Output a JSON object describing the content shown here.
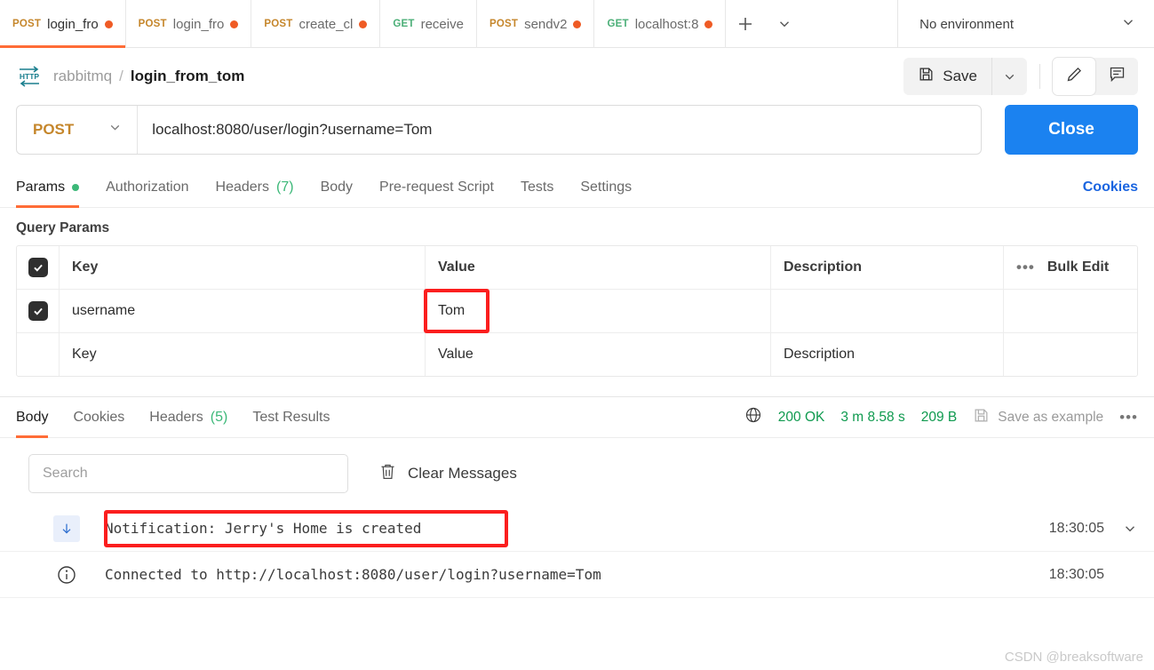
{
  "tabbar": {
    "tabs": [
      {
        "method": "POST",
        "name": "login_from_tom",
        "display": "login_fro",
        "dirty": true,
        "active": true
      },
      {
        "method": "POST",
        "name": "login_from_jerry",
        "display": "login_fro",
        "dirty": true,
        "active": false
      },
      {
        "method": "POST",
        "name": "create_cl",
        "display": "create_cl",
        "dirty": true,
        "active": false
      },
      {
        "method": "GET",
        "name": "receive",
        "display": "receive",
        "dirty": false,
        "active": false
      },
      {
        "method": "POST",
        "name": "sendv2",
        "display": "sendv2",
        "dirty": true,
        "active": false
      },
      {
        "method": "GET",
        "name": "localhost:8",
        "display": "localhost:8",
        "dirty": true,
        "active": false
      }
    ],
    "new_tab_label": "+",
    "tab_list_caret": "chevron-down",
    "environment": "No environment"
  },
  "header": {
    "protocol_icon": "HTTP",
    "collection": "rabbitmq",
    "separator": "/",
    "request_name": "login_from_tom",
    "save_label": "Save",
    "save_caret": "chevron-down",
    "edit_icon": "pencil-icon",
    "comment_icon": "comment-icon"
  },
  "request": {
    "method": "POST",
    "method_caret": "chevron-down",
    "url": "localhost:8080/user/login?username=Tom",
    "action_label": "Close",
    "tabs": [
      {
        "label": "Params",
        "badge_dot": true,
        "active": true
      },
      {
        "label": "Authorization",
        "active": false
      },
      {
        "label": "Headers",
        "count": "(7)",
        "active": false
      },
      {
        "label": "Body",
        "active": false
      },
      {
        "label": "Pre-request Script",
        "active": false
      },
      {
        "label": "Tests",
        "active": false
      },
      {
        "label": "Settings",
        "active": false
      }
    ],
    "cookies_link": "Cookies"
  },
  "query_params": {
    "section_title": "Query Params",
    "headers": {
      "key": "Key",
      "value": "Value",
      "description": "Description",
      "bulk_edit": "Bulk Edit",
      "more": "•••"
    },
    "rows": [
      {
        "checked": true,
        "key": "username",
        "value": "Tom",
        "description": "",
        "value_highlighted": true
      },
      {
        "checked": false,
        "key": "",
        "value": "",
        "description": "",
        "key_placeholder": "Key",
        "value_placeholder": "Value",
        "description_placeholder": "Description"
      }
    ]
  },
  "response": {
    "tabs": [
      {
        "label": "Body",
        "active": true
      },
      {
        "label": "Cookies",
        "active": false
      },
      {
        "label": "Headers",
        "count": "(5)",
        "active": false
      },
      {
        "label": "Test Results",
        "active": false
      }
    ],
    "globe_icon": "globe-icon",
    "status": "200 OK",
    "time": "3 m 8.58 s",
    "size": "209 B",
    "save_example_label": "Save as example",
    "more_icon": "•••",
    "search_placeholder": "Search",
    "clear_messages_label": "Clear Messages",
    "messages": [
      {
        "direction_icon": "arrow-down-icon",
        "text": "Notification: Jerry's Home is created",
        "time": "18:30:05",
        "caret": "chevron-down",
        "highlighted": true
      },
      {
        "direction_icon": "info-icon",
        "text": "Connected to http://localhost:8080/user/login?username=Tom",
        "time": "18:30:05",
        "highlighted": false
      }
    ]
  },
  "watermark": "CSDN @breaksoftware",
  "colors": {
    "accent_orange": "#ff6c37",
    "post_method": "#c5862b",
    "get_method": "#4caf78",
    "primary_blue": "#1b82f0",
    "link_blue": "#1b65e0",
    "success_green": "#0f9a4f",
    "annotation_red": "#fb1e1e"
  }
}
